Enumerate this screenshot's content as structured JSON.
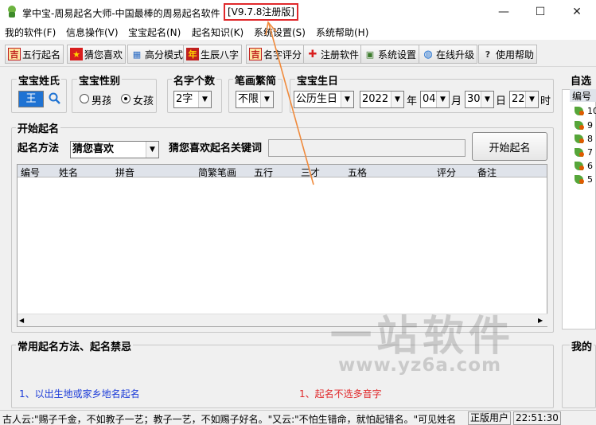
{
  "window": {
    "title": "掌中宝-周易起名大师-中国最棒的周易起名软件",
    "version": "[V9.7.8注册版]",
    "minimize": "—",
    "maximize": "☐",
    "close": "✕"
  },
  "menu": [
    "我的软件(F)",
    "信息操作(V)",
    "宝宝起名(N)",
    "起名知识(K)",
    "系统设置(S)",
    "系统帮助(H)"
  ],
  "toolbar": [
    {
      "label": "五行起名",
      "icon": "吉"
    },
    {
      "label": "猜您喜欢",
      "icon": "★"
    },
    {
      "label": "高分模式",
      "icon": "▦"
    },
    {
      "label": "生辰八字",
      "icon": "年"
    },
    {
      "label": "名字评分",
      "icon": "吉"
    },
    {
      "label": "注册软件",
      "icon": "✚"
    },
    {
      "label": "系统设置",
      "icon": "▣"
    },
    {
      "label": "在线升级",
      "icon": "◍"
    },
    {
      "label": "使用帮助",
      "icon": "?"
    }
  ],
  "form": {
    "surname_label": "宝宝姓氏",
    "surname_value": "王",
    "gender_label": "宝宝性别",
    "gender_male": "男孩",
    "gender_female": "女孩",
    "name_count_label": "名字个数",
    "name_count_value": "2字",
    "stroke_label": "笔画繁简",
    "stroke_value": "不限",
    "birthday_label": "宝宝生日",
    "calendar_value": "公历生日",
    "year_value": "2022",
    "year_unit": "年",
    "month_value": "04",
    "month_unit": "月",
    "day_value": "30",
    "day_unit": "日",
    "hour_value": "22",
    "hour_unit": "时"
  },
  "start": {
    "section_label": "开始起名",
    "method_label": "起名方法",
    "method_value": "猜您喜欢",
    "keyword_label": "猜您喜欢起名关键词",
    "keyword_value": "",
    "button": "开始起名"
  },
  "table": {
    "columns": [
      "编号",
      "姓名",
      "拼音",
      "简繁笔画",
      "五行",
      "三才",
      "五格",
      "评分",
      "备注"
    ]
  },
  "right_panel": {
    "label": "自选",
    "column": "编号",
    "items": [
      "10",
      "9",
      "8",
      "7",
      "6",
      "5"
    ]
  },
  "methods": {
    "label": "常用起名方法、起名禁忌",
    "left_item": "1、以出生地或家乡地名起名",
    "right_item": "1、起名不选多音字",
    "right_label": "我的"
  },
  "watermark": {
    "cn": "一站软件",
    "url": "www.yz6a.com"
  },
  "status": {
    "quote": "古人云:\"赐子千金，不如教子一艺；教子一艺，不如赐子好名。\"又云:\"不怕生错命，就怕起错名。\"可见姓名",
    "edition": "正版用户",
    "time": "22:51:30"
  },
  "colors": {
    "accent_red": "#e0292b",
    "annotation_orange": "#f08a3c",
    "link_blue": "#1a3ad8"
  }
}
